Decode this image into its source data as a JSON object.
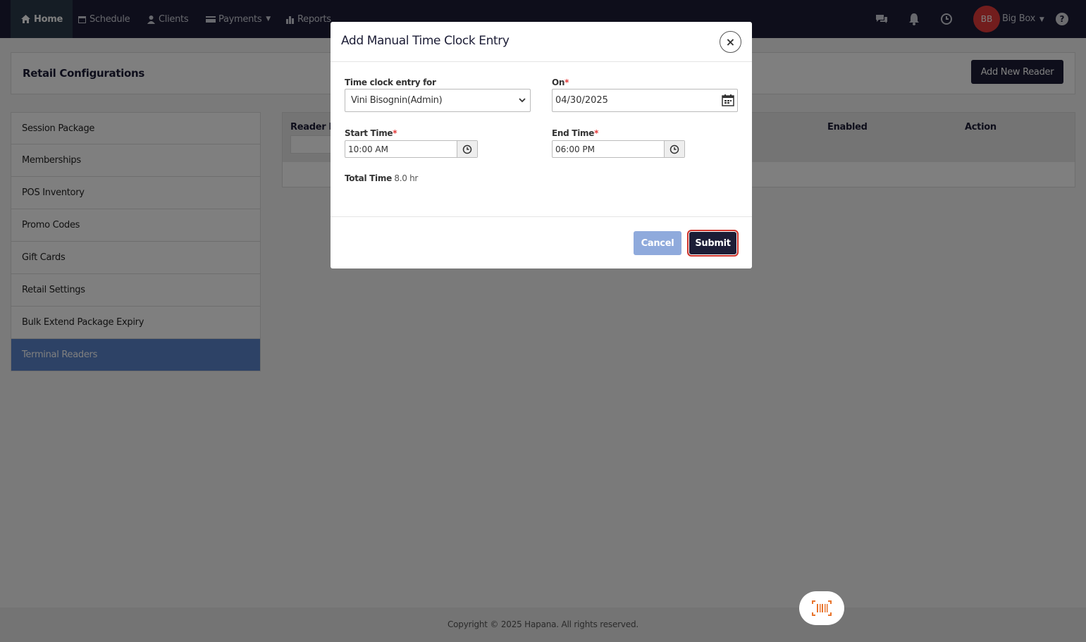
{
  "nav": {
    "home": "Home",
    "schedule": "Schedule",
    "clients": "Clients",
    "payments": "Payments",
    "reports": "Reports",
    "user_initials": "BB",
    "user_name": "Big Box"
  },
  "page": {
    "title": "Retail Configurations",
    "add_reader_button": "Add New Reader"
  },
  "sidebar": {
    "items": [
      {
        "label": "Session Package"
      },
      {
        "label": "Memberships"
      },
      {
        "label": "POS Inventory"
      },
      {
        "label": "Promo Codes"
      },
      {
        "label": "Gift Cards"
      },
      {
        "label": "Retail Settings"
      },
      {
        "label": "Bulk Extend Package Expiry"
      },
      {
        "label": "Terminal Readers",
        "active": true
      }
    ]
  },
  "table": {
    "columns": [
      "Reader N",
      "Enabled",
      "Action"
    ]
  },
  "modal": {
    "title": "Add Manual Time Clock Entry",
    "entry_for_label": "Time clock entry for",
    "entry_for_value": "Vini Bisognin(Admin)",
    "on_label": "On",
    "on_value": "04/30/2025",
    "start_label": "Start Time",
    "start_value": "10:00 AM",
    "end_label": "End Time",
    "end_value": "06:00 PM",
    "total_label": "Total Time",
    "total_value": "8.0 hr",
    "required_mark": "*",
    "cancel_label": "Cancel",
    "submit_label": "Submit",
    "close_glyph": "×"
  },
  "footer": {
    "copyright": "Copyright © 2025 Hapana. All rights reserved."
  },
  "colors": {
    "navbar": "#1c1d36",
    "accent": "#5b85cc",
    "avatar": "#e53b3b",
    "submit_outline": "#d0342c",
    "scan_icon": "#e8742c"
  }
}
